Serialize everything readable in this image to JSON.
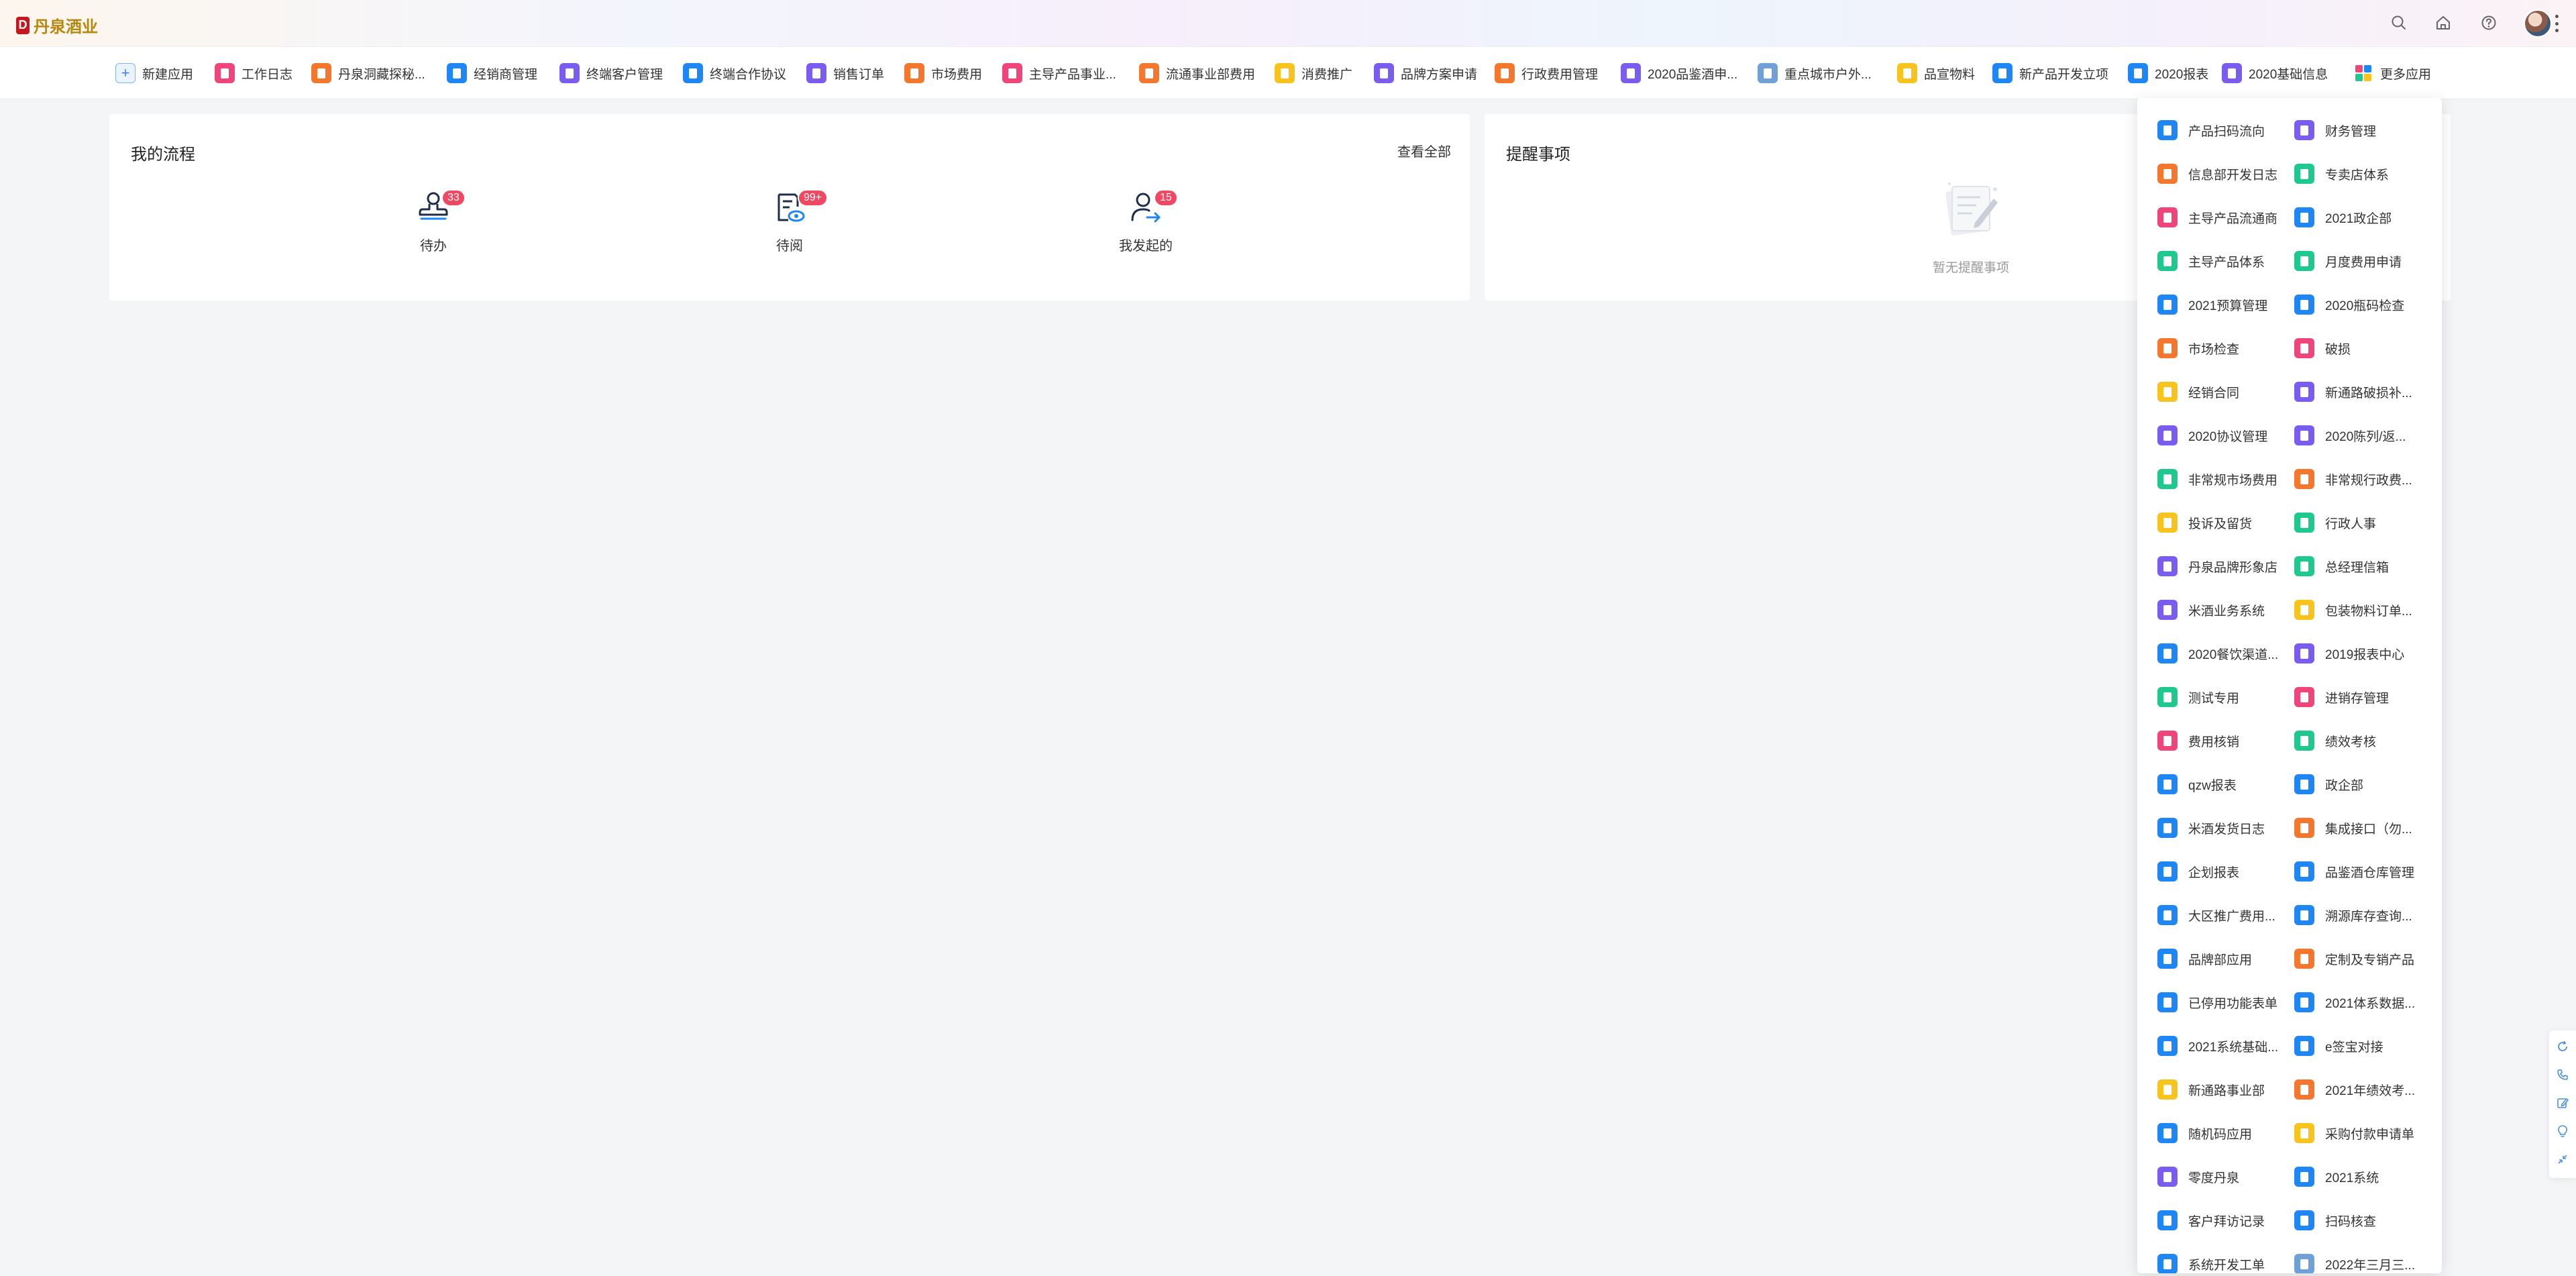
{
  "header": {
    "logo_mark": "D",
    "logo_text": "丹泉酒业",
    "icons": [
      "search-icon",
      "home-icon",
      "help-icon"
    ]
  },
  "tabs": [
    {
      "label": "新建应用",
      "color": "#eaf3ff",
      "type": "plus"
    },
    {
      "label": "工作日志",
      "color": "#f0457a"
    },
    {
      "label": "丹泉洞藏探秘...",
      "color": "#f5762d"
    },
    {
      "label": "经销商管理",
      "color": "#1e86f5"
    },
    {
      "label": "终端客户管理",
      "color": "#7b5cf0"
    },
    {
      "label": "终端合作协议",
      "color": "#1e86f5"
    },
    {
      "label": "销售订单",
      "color": "#7b5cf0"
    },
    {
      "label": "市场费用",
      "color": "#f5762d"
    },
    {
      "label": "主导产品事业...",
      "color": "#f0457a"
    },
    {
      "label": "流通事业部费用",
      "color": "#f5762d"
    },
    {
      "label": "消费推广",
      "color": "#f7c31c"
    },
    {
      "label": "品牌方案申请",
      "color": "#7b5cf0"
    },
    {
      "label": "行政费用管理",
      "color": "#f5762d"
    },
    {
      "label": "2020品鉴酒申...",
      "color": "#7b5cf0"
    },
    {
      "label": "重点城市户外...",
      "color": "#6fa0d8"
    },
    {
      "label": "品宣物料",
      "color": "#f7c31c"
    },
    {
      "label": "新产品开发立项",
      "color": "#1e86f5"
    },
    {
      "label": "2020报表",
      "color": "#1e86f5"
    },
    {
      "label": "2020基础信息",
      "color": "#7b5cf0"
    },
    {
      "label": "更多应用",
      "color": "multi"
    }
  ],
  "my_flow": {
    "title": "我的流程",
    "view_all": "查看全部",
    "items": [
      {
        "label": "待办",
        "badge": "33",
        "icon": "stamp-icon"
      },
      {
        "label": "待阅",
        "badge": "99+",
        "icon": "document-view-icon"
      },
      {
        "label": "我发起的",
        "badge": "15",
        "icon": "user-forward-icon"
      }
    ]
  },
  "reminders": {
    "title": "提醒事项",
    "empty_text": "暂无提醒事项"
  },
  "more_apps": [
    [
      "产品扫码流向",
      "#1e86f5"
    ],
    [
      "财务管理",
      "#7b5cf0"
    ],
    [
      "信息部开发日志",
      "#f5762d"
    ],
    [
      "专卖店体系",
      "#1fc98e"
    ],
    [
      "主导产品流通商",
      "#f0457a"
    ],
    [
      "2021政企部",
      "#1e86f5"
    ],
    [
      "主导产品体系",
      "#1fc98e"
    ],
    [
      "月度费用申请",
      "#1fc98e"
    ],
    [
      "2021预算管理",
      "#1e86f5"
    ],
    [
      "2020瓶码检查",
      "#1e86f5"
    ],
    [
      "市场检查",
      "#f5762d"
    ],
    [
      "破损",
      "#f0457a"
    ],
    [
      "经销合同",
      "#f7c31c"
    ],
    [
      "新通路破损补...",
      "#7b5cf0"
    ],
    [
      "2020协议管理",
      "#7b5cf0"
    ],
    [
      "2020陈列/返...",
      "#7b5cf0"
    ],
    [
      "非常规市场费用",
      "#1fc98e"
    ],
    [
      "非常规行政费...",
      "#f5762d"
    ],
    [
      "投诉及留货",
      "#f7c31c"
    ],
    [
      "行政人事",
      "#1fc98e"
    ],
    [
      "丹泉品牌形象店",
      "#7b5cf0"
    ],
    [
      "总经理信箱",
      "#1fc98e"
    ],
    [
      "米酒业务系统",
      "#7b5cf0"
    ],
    [
      "包装物料订单...",
      "#f7c31c"
    ],
    [
      "2020餐饮渠道...",
      "#1e86f5"
    ],
    [
      "2019报表中心",
      "#7b5cf0"
    ],
    [
      "测试专用",
      "#1fc98e"
    ],
    [
      "进销存管理",
      "#f0457a"
    ],
    [
      "费用核销",
      "#f0457a"
    ],
    [
      "绩效考核",
      "#1fc98e"
    ],
    [
      "qzw报表",
      "#1e86f5"
    ],
    [
      "政企部",
      "#1e86f5"
    ],
    [
      "米酒发货日志",
      "#1e86f5"
    ],
    [
      "集成接口（勿...",
      "#f5762d"
    ],
    [
      "企划报表",
      "#1e86f5"
    ],
    [
      "品鉴酒仓库管理",
      "#1e86f5"
    ],
    [
      "大区推广费用...",
      "#1e86f5"
    ],
    [
      "溯源库存查询...",
      "#1e86f5"
    ],
    [
      "品牌部应用",
      "#1e86f5"
    ],
    [
      "定制及专销产品",
      "#f5762d"
    ],
    [
      "已停用功能表单",
      "#1e86f5"
    ],
    [
      "2021体系数据...",
      "#1e86f5"
    ],
    [
      "2021系统基础...",
      "#1e86f5"
    ],
    [
      "e签宝对接",
      "#1e86f5"
    ],
    [
      "新通路事业部",
      "#f7c31c"
    ],
    [
      "2021年绩效考...",
      "#f5762d"
    ],
    [
      "随机码应用",
      "#1e86f5"
    ],
    [
      "采购付款申请单",
      "#f7c31c"
    ],
    [
      "零度丹泉",
      "#7b5cf0"
    ],
    [
      "2021系统",
      "#1e86f5"
    ],
    [
      "客户拜访记录",
      "#1e86f5"
    ],
    [
      "扫码核查",
      "#1e86f5"
    ],
    [
      "系统开发工单",
      "#1e86f5"
    ],
    [
      "2022年三月三...",
      "#6fa0d8"
    ]
  ],
  "float_tools": [
    "refresh-icon",
    "phone-icon",
    "edit-icon",
    "bulb-icon",
    "collapse-icon"
  ]
}
